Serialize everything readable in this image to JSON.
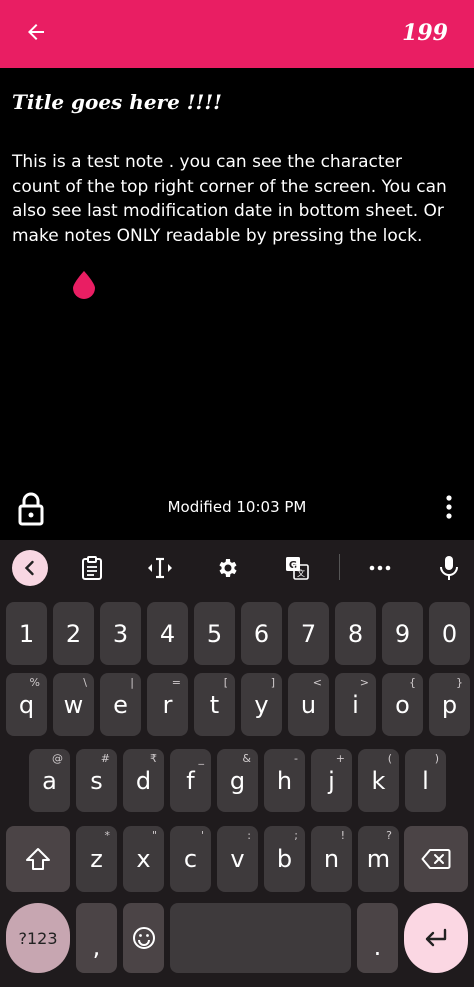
{
  "app_bar": {
    "back_icon": "arrow-left-icon",
    "char_count": "199"
  },
  "note": {
    "title": "Title goes here !!!!",
    "body": "This is a test note . you can see the character count of the top right corner of the screen. You can also see last modification date in bottom sheet. Or make notes ONLY readable by pressing the lock."
  },
  "bottom_bar": {
    "lock_icon": "lock-icon",
    "modified": "Modified 10:03 PM",
    "more_icon": "more-vert-icon"
  },
  "keyboard": {
    "toolbar_icons": [
      "chevron-left-icon",
      "clipboard-icon",
      "text-cursor-icon",
      "gear-icon",
      "translate-icon",
      "more-horiz-icon",
      "mic-icon"
    ],
    "number_row": [
      "1",
      "2",
      "3",
      "4",
      "5",
      "6",
      "7",
      "8",
      "9",
      "0"
    ],
    "row1": [
      {
        "k": "q",
        "alt": "%"
      },
      {
        "k": "w",
        "alt": "\\"
      },
      {
        "k": "e",
        "alt": "|"
      },
      {
        "k": "r",
        "alt": "="
      },
      {
        "k": "t",
        "alt": "["
      },
      {
        "k": "y",
        "alt": "]"
      },
      {
        "k": "u",
        "alt": "<"
      },
      {
        "k": "i",
        "alt": ">"
      },
      {
        "k": "o",
        "alt": "{"
      },
      {
        "k": "p",
        "alt": "}"
      }
    ],
    "row2": [
      {
        "k": "a",
        "alt": "@"
      },
      {
        "k": "s",
        "alt": "#"
      },
      {
        "k": "d",
        "alt": "₹"
      },
      {
        "k": "f",
        "alt": "_"
      },
      {
        "k": "g",
        "alt": "&"
      },
      {
        "k": "h",
        "alt": "-"
      },
      {
        "k": "j",
        "alt": "+"
      },
      {
        "k": "k",
        "alt": "("
      },
      {
        "k": "l",
        "alt": ")"
      }
    ],
    "row3": [
      {
        "k": "z",
        "alt": "*"
      },
      {
        "k": "x",
        "alt": "\""
      },
      {
        "k": "c",
        "alt": "'"
      },
      {
        "k": "v",
        "alt": ":"
      },
      {
        "k": "b",
        "alt": ";"
      },
      {
        "k": "n",
        "alt": "!"
      },
      {
        "k": "m",
        "alt": "?"
      }
    ],
    "symbols_label": "?123",
    "comma": ",",
    "period": ".",
    "colors": {
      "accent": "#e91e63",
      "key": "#3e3a3c",
      "key_dark": "#4b4446",
      "enter": "#fbd7e3"
    }
  }
}
